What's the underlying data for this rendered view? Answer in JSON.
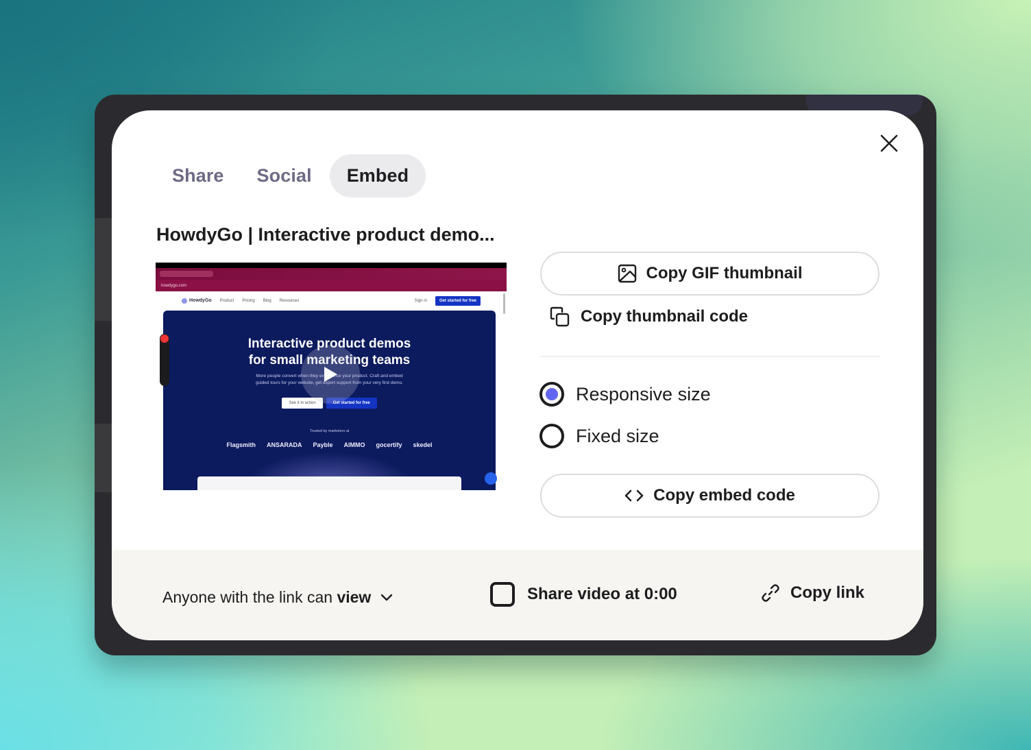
{
  "dialog": {
    "close_icon": "close-icon",
    "tabs": [
      {
        "label": "Share",
        "active": false
      },
      {
        "label": "Social",
        "active": false
      },
      {
        "label": "Embed",
        "active": true
      }
    ],
    "video_title": "HowdyGo | Interactive product demo...",
    "thumbnail": {
      "browser_url": "howdygo.com",
      "site_nav": {
        "logo": "HowdyGo",
        "items": [
          "Product",
          "Pricing",
          "Blog",
          "Resources"
        ],
        "sign_in": "Sign in",
        "cta": "Get started for free"
      },
      "hero": {
        "headline_line1": "Interactive product demos",
        "headline_line2": "for small marketing teams",
        "subtext_line1": "More people convert when they experience your product. Craft and embed",
        "subtext_line2": "guided tours for your website, get expert support from your very first demo.",
        "btn_secondary": "See it in action",
        "btn_primary": "Get started for free",
        "trusted": "Trusted by marketers at",
        "logos": [
          "Flagsmith",
          "ANSARADA",
          "Payble",
          "AIMMO",
          "gocertify",
          "skedel"
        ]
      },
      "play_icon": "play-icon"
    },
    "actions": {
      "copy_gif_thumbnail": {
        "label": "Copy GIF thumbnail",
        "icon": "image-icon"
      },
      "copy_thumbnail_code": {
        "label": "Copy thumbnail code",
        "icon": "copy-icon"
      },
      "size_options": [
        {
          "label": "Responsive size",
          "selected": true
        },
        {
          "label": "Fixed size",
          "selected": false
        }
      ],
      "copy_embed_code": {
        "label": "Copy embed code",
        "icon": "code-icon"
      }
    },
    "footer": {
      "permission_prefix": "Anyone with the link can",
      "permission_value": "view",
      "share_at_label": "Share video at 0:00",
      "share_at_checked": false,
      "copy_link_label": "Copy link"
    },
    "colors": {
      "accent": "#6366f1",
      "text": "#1d1d1f",
      "tab_inactive": "#6c6a86",
      "footer_bg": "#f6f5f1"
    }
  }
}
